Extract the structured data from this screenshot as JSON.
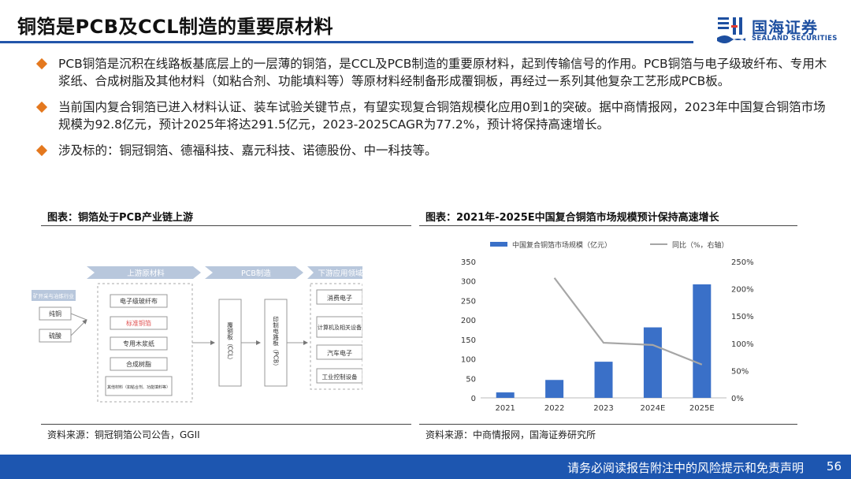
{
  "slide": {
    "title": "铜箔是PCB及CCL制造的重要原材料",
    "page_number": "56",
    "footer": "请务必阅读报告附注中的风险提示和免责声明"
  },
  "logo": {
    "name_cn": "国海证券",
    "name_en": "SEALAND SECURITIES"
  },
  "bullets": [
    "PCB铜箔是沉积在线路板基底层上的一层薄的铜箔，是CCL及PCB制造的重要原材料，起到传输信号的作用。PCB铜箔与电子级玻纤布、专用木浆纸、合成树脂及其他材料（如粘合剂、功能填料等）等原材料经制备形成覆铜板，再经过一系列其他复杂工艺形成PCB板。",
    "当前国内复合铜箔已进入材料认证、装车试验关键节点，有望实现复合铜箔规模化应用0到1的突破。据中商情报网，2023年中国复合铜箔市场规模为92.8亿元，预计2025年将达291.5亿元，2023-2025CAGR为77.2%，预计将保持高速增长。",
    "涉及标的：铜冠铜箔、德福科技、嘉元科技、诺德股份、中一科技等。"
  ],
  "left_figure": {
    "caption": "图表：铜箔处于PCB产业链上游",
    "source": "资料来源：铜冠铜箔公司公告，GGII",
    "sections": {
      "upstream": "上游原材料",
      "pcb": "PCB制造",
      "downstream": "下游应用领域"
    },
    "mining": {
      "label": "矿开采与冶炼行业",
      "items": [
        "纯铜",
        "硫酸"
      ]
    },
    "materials": [
      "电子级玻纤布",
      "标准铜箔",
      "专用木浆纸",
      "合成树脂",
      "其他材料（如粘合剂、功能填料等）"
    ],
    "ccl": "覆铜板（CCL）",
    "pcb_board": "印制电路板（PCB）",
    "applications": [
      "消费电子",
      "计算机及相关设备",
      "汽车电子",
      "工业控制设备"
    ],
    "colors": {
      "highlight_text": "#e05050",
      "header_fill": "#b8c7dc"
    }
  },
  "right_figure": {
    "caption": "图表：2021年-2025E中国复合铜箔市场规模预计保持高速增长",
    "source": "资料来源：中商情报网，国海证券研究所"
  },
  "chart_data": {
    "type": "bar",
    "categories": [
      "2021",
      "2022",
      "2023",
      "2024E",
      "2025E"
    ],
    "series": [
      {
        "name": "中国复合铜箔市场规模（亿元）",
        "type": "bar",
        "axis": "left",
        "color": "#3a70c8",
        "values": [
          14,
          46,
          92.8,
          181,
          291.5
        ]
      },
      {
        "name": "同比（%，右轴）",
        "type": "line",
        "axis": "right",
        "color": "#a6a6a6",
        "values": [
          null,
          220,
          101,
          97,
          61
        ]
      }
    ],
    "ylim": [
      0,
      350
    ],
    "yticks": [
      0,
      50,
      100,
      150,
      200,
      250,
      300,
      350
    ],
    "y2lim": [
      0,
      250
    ],
    "y2ticks": [
      "0%",
      "50%",
      "100%",
      "150%",
      "200%",
      "250%"
    ],
    "legend": "top",
    "grid": false
  }
}
